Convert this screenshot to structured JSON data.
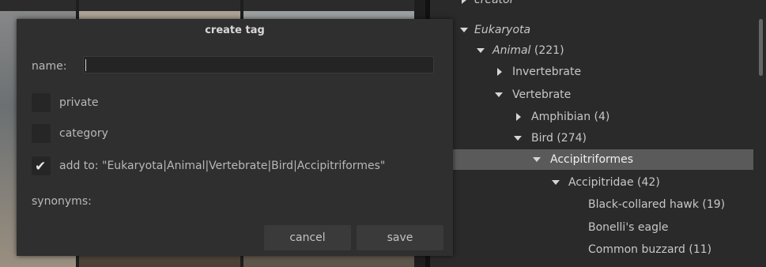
{
  "dialog": {
    "title": "create tag",
    "name_label": "name:",
    "name_value": "",
    "private_label": "private",
    "private_checked": false,
    "category_label": "category",
    "category_checked": false,
    "add_to_label": "add to: \"Eukaryota|Animal|Vertebrate|Bird|Accipitriformes\"",
    "add_to_checked": true,
    "synonyms_label": "synonyms:",
    "cancel_label": "cancel",
    "save_label": "save"
  },
  "tree": {
    "rows": [
      {
        "label": "creator",
        "expanded": false
      },
      {
        "label": "Eukaryota",
        "expanded": true
      },
      {
        "label": "Animal (221)",
        "expanded": true
      },
      {
        "label": "Invertebrate",
        "expanded": false
      },
      {
        "label": "Vertebrate",
        "expanded": true
      },
      {
        "label": "Amphibian (4)",
        "expanded": false
      },
      {
        "label": "Bird (274)",
        "expanded": true
      },
      {
        "label": "Accipitriformes",
        "expanded": true,
        "selected": true
      },
      {
        "label": "Accipitridae (42)",
        "expanded": true
      },
      {
        "label": "Black-collared hawk (19)"
      },
      {
        "label": "Bonelli's eagle"
      },
      {
        "label": "Common buzzard (11)"
      }
    ]
  },
  "colors": {
    "selected_row": "#5a5a5a",
    "dialog_bg": "#2f2f2f",
    "panel_bg": "#2a2a2a"
  }
}
